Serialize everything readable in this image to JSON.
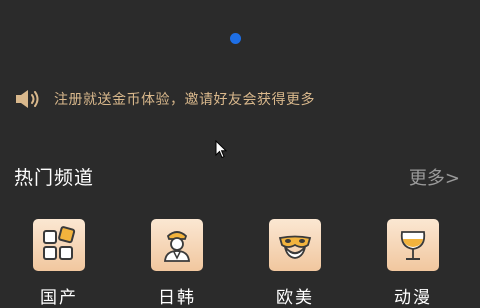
{
  "notice": {
    "icon": "speaker-icon",
    "text": "注册就送金币体验，邀请好友会获得更多"
  },
  "section": {
    "title": "热门频道",
    "more_label": "更多>"
  },
  "channels": [
    {
      "label": "国产",
      "icon": "grid-icon"
    },
    {
      "label": "日韩",
      "icon": "person-icon"
    },
    {
      "label": "欧美",
      "icon": "mask-icon"
    },
    {
      "label": "动漫",
      "icon": "wine-glass-icon"
    }
  ],
  "colors": {
    "background": "#2b2b2b",
    "notice_text": "#d9b88c",
    "tile_gradient_top": "#fbe7d2",
    "tile_gradient_bottom": "#f1c79f",
    "dot": "#1e6fe6"
  }
}
